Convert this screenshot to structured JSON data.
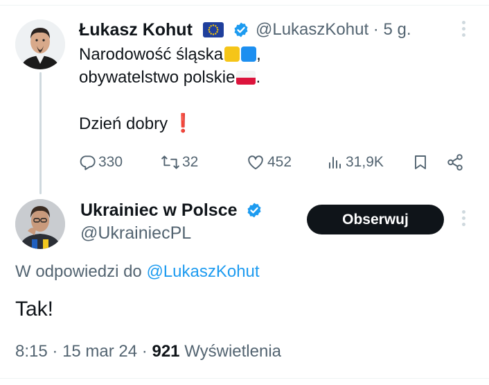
{
  "original_tweet": {
    "author_name": "Łukasz Kohut",
    "handle": "@LukaszKohut",
    "separator": "·",
    "time_ago": "5 g.",
    "text_line1": "Narodowość śląska",
    "text_line1_tail": ",",
    "text_line2": "obywatelstwo polskie",
    "text_line2_tail": ".",
    "text_line3": "Dzień dobry",
    "text_line3_emoji": "❗",
    "stats": {
      "replies": "330",
      "reposts": "32",
      "likes": "452",
      "views": "31,9K"
    }
  },
  "reply_tweet": {
    "author_name": "Ukrainiec w Polsce",
    "handle": "@UkrainiecPL",
    "follow_label": "Obserwuj",
    "reply_to_prefix": "W odpowiedzi do",
    "reply_to_mention": "@LukaszKohut",
    "text": "Tak!",
    "time": "8:15",
    "dot1": "·",
    "date": "15 mar 24",
    "dot2": "·",
    "views_count": "921",
    "views_label": "Wyświetlenia"
  },
  "colors": {
    "verified": "#1d9bf0",
    "mention": "#1d9bf0",
    "secondary_text": "#536471",
    "follow_button_bg": "#0f1419",
    "silesian_yellow": "#f5c518",
    "silesian_blue": "#1d8ff0",
    "poland_red": "#dc143c"
  },
  "icons": [
    "eu-flag-icon",
    "verified-badge-icon",
    "more-options-icon",
    "reply-icon",
    "repost-icon",
    "like-icon",
    "views-icon",
    "bookmark-icon",
    "share-icon"
  ]
}
